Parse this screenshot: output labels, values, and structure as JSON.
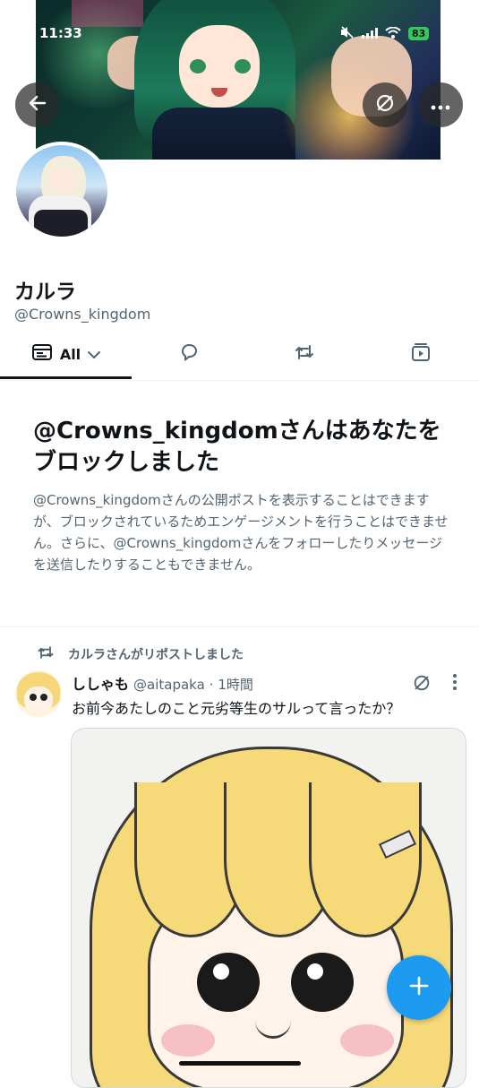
{
  "status_bar": {
    "time": "11:33",
    "battery": "83"
  },
  "profile": {
    "display_name": "カルラ",
    "handle": "@Crowns_kingdom"
  },
  "tabs": [
    {
      "label": "All",
      "icon": "posts-icon",
      "active": true
    },
    {
      "label": "",
      "icon": "reply-icon",
      "active": false
    },
    {
      "label": "",
      "icon": "repost-icon",
      "active": false
    },
    {
      "label": "",
      "icon": "media-icon",
      "active": false
    }
  ],
  "blocked_notice": {
    "title": "@Crowns_kingdomさんはあなたをブロックしました",
    "body": "@Crowns_kingdomさんの公開ポストを表示することはできますが、ブロックされているためエンゲージメントを行うことはできません。さらに、@Crowns_kingdomさんをフォローしたりメッセージを送信したりすることもできません。"
  },
  "post": {
    "repost_label": "カルラさんがリポストしました",
    "author_name": "ししゃも",
    "author_handle": "@aitapaka",
    "time": "· 1時間",
    "text": "お前今あたしのこと元劣等生のサルって言ったか？"
  },
  "colors": {
    "accent": "#1d9bf0",
    "text_primary": "#0f1419",
    "text_secondary": "#536471",
    "battery": "#34c759"
  }
}
